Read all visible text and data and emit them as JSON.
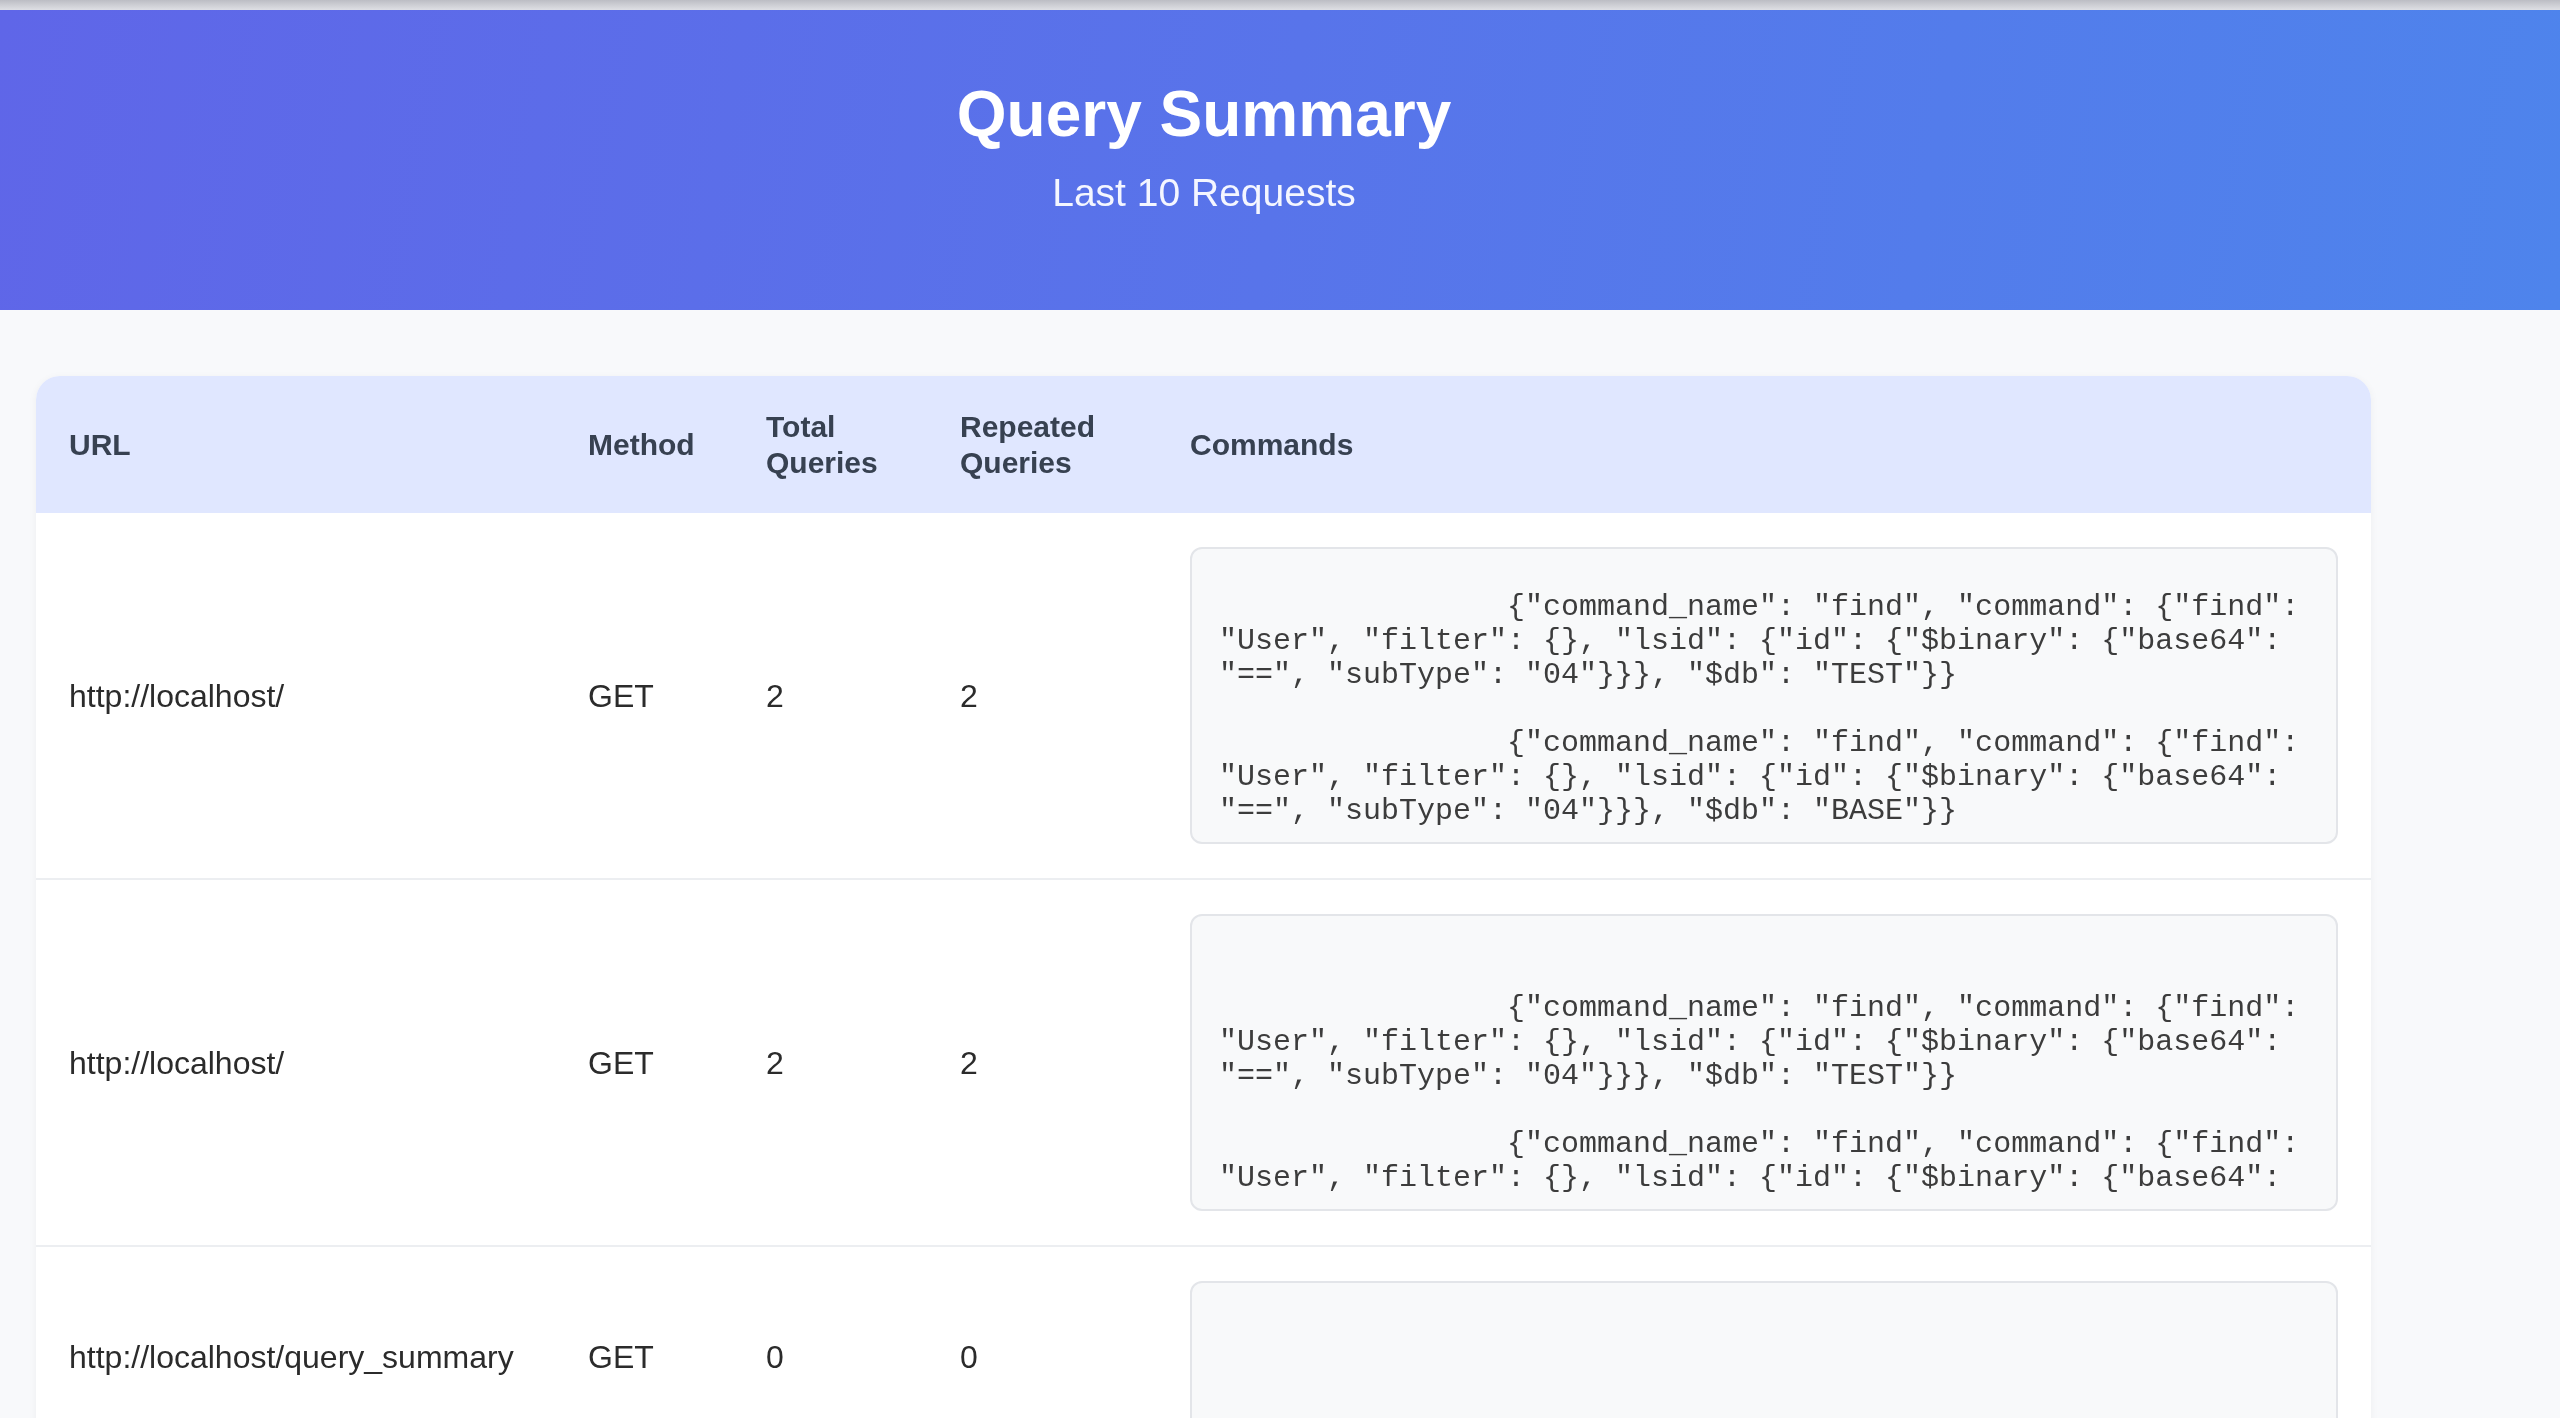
{
  "header": {
    "title": "Query Summary",
    "subtitle": "Last 10 Requests"
  },
  "table": {
    "columns": [
      "URL",
      "Method",
      "Total Queries",
      "Repeated Queries",
      "Commands"
    ],
    "rows": [
      {
        "url": "http://localhost/",
        "method": "GET",
        "total_queries": "2",
        "repeated_queries": "2",
        "commands": [
          "{\"command_name\": \"find\", \"command\": {\"find\": \"User\", \"filter\": {}, \"lsid\": {\"id\": {\"$binary\": {\"base64\": \"==\", \"subType\": \"04\"}}}, \"$db\": \"TEST\"}}",
          "{\"command_name\": \"find\", \"command\": {\"find\": \"User\", \"filter\": {}, \"lsid\": {\"id\": {\"$binary\": {\"base64\": \"==\", \"subType\": \"04\"}}}, \"$db\": \"BASE\"}}"
        ]
      },
      {
        "url": "http://localhost/",
        "method": "GET",
        "total_queries": "2",
        "repeated_queries": "2",
        "commands": [
          "{\"command_name\": \"find\", \"command\": {\"find\": \"User\", \"filter\": {}, \"lsid\": {\"id\": {\"$binary\": {\"base64\": \"==\", \"subType\": \"04\"}}}, \"$db\": \"TEST\"}}",
          "{\"command_name\": \"find\", \"command\": {\"find\": \"User\", \"filter\": {}, \"lsid\": {\"id\": {\"$binary\": {\"base64\":"
        ]
      },
      {
        "url": "http://localhost/query_summary",
        "method": "GET",
        "total_queries": "0",
        "repeated_queries": "0"
      }
    ]
  }
}
